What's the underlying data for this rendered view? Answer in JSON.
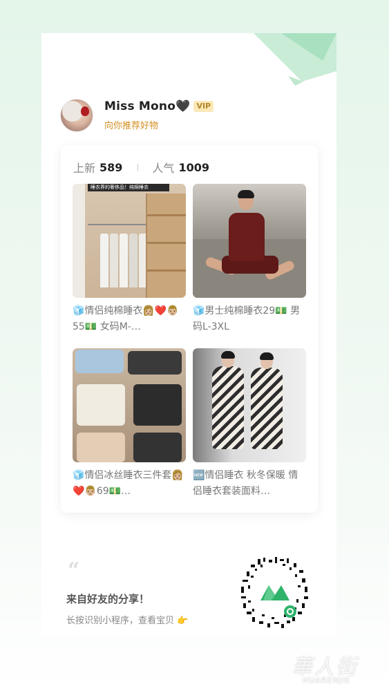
{
  "profile": {
    "name": "Miss Mono🖤",
    "badge": "VIP",
    "subtitle": "向你推荐好物"
  },
  "stats": {
    "new_label": "上新",
    "new_value": "589",
    "popularity_label": "人气",
    "popularity_value": "1009"
  },
  "products": [
    {
      "caption": "🧊情侣纯棉睡衣👩🏼❤️👨🏼55💵 女码M-…",
      "image_text": "睡衣界的奢侈品！纯棉睡衣"
    },
    {
      "caption": "🧊男士纯棉睡衣29💵 男码L-3XL"
    },
    {
      "caption": "🧊情侣冰丝睡衣三件套👩🏼❤️👨🏼69💵…"
    },
    {
      "caption": "🆕情侣睡衣 秋冬保暖 情侣睡衣套装面料…"
    }
  ],
  "share": {
    "quote_mark": "“",
    "title": "来自好友的分享！",
    "hint": "长按识别小程序，查看宝贝 👉"
  },
  "watermark": {
    "cn": "華人街",
    "en": "HUARENJIE"
  },
  "icons": {
    "qr": "mini-program-qr-icon",
    "deco": "corner-decoration"
  },
  "colors": {
    "accent_green": "#2fb36b",
    "gold": "#d39023",
    "vip_bg": "#fbe8b8"
  }
}
